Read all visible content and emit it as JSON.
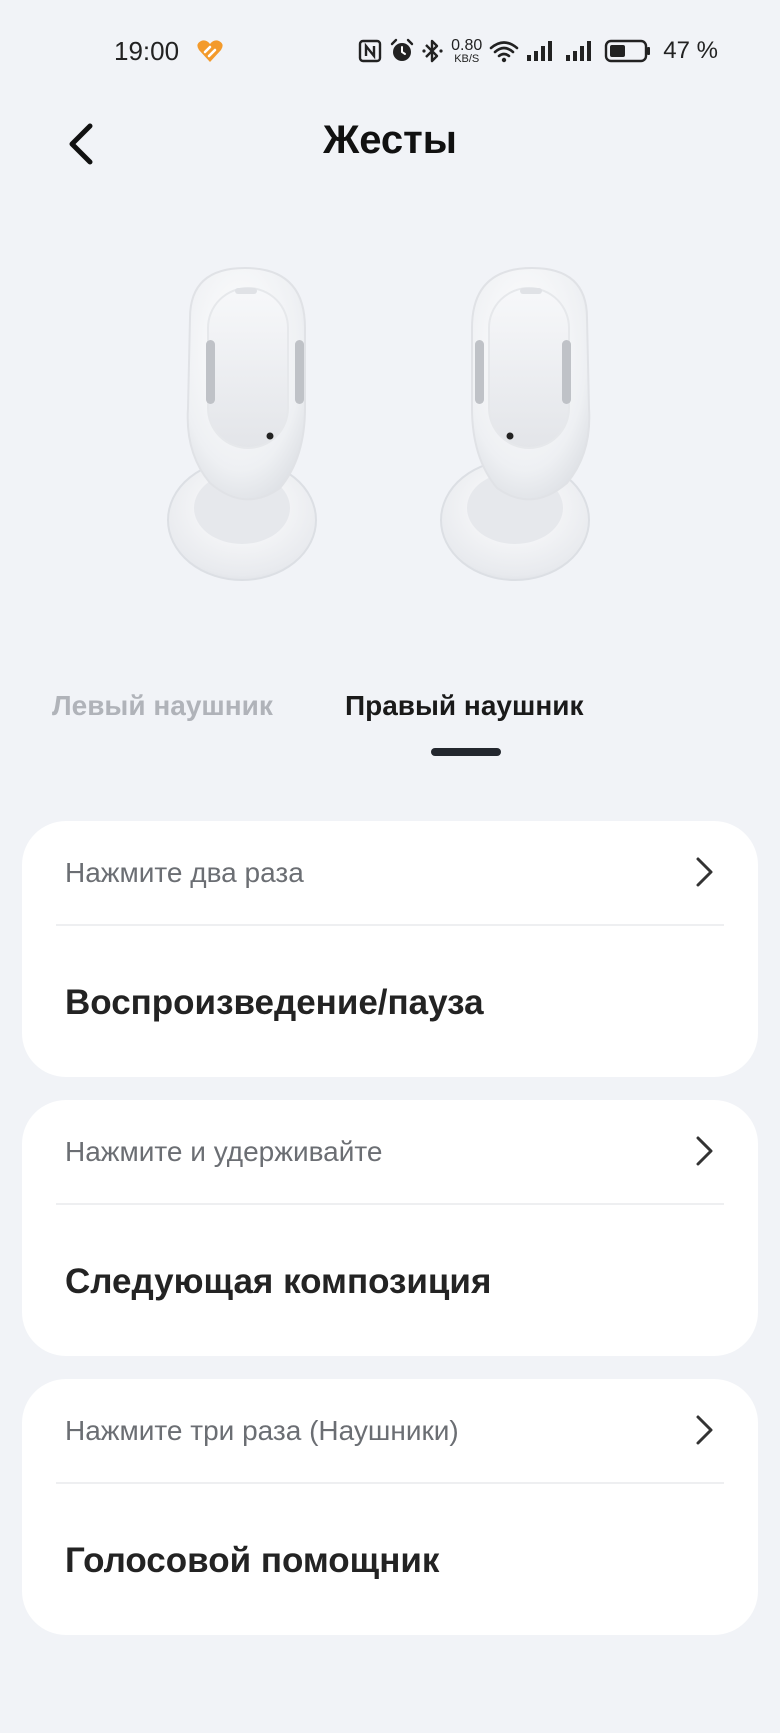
{
  "status_bar": {
    "time": "19:00",
    "app_icon": "orange-heart-icon",
    "icons": [
      "nfc-icon",
      "alarm-icon",
      "bluetooth-icon",
      "wifi-icon",
      "signal-icon",
      "signal-icon",
      "battery-icon"
    ],
    "net_speed_value": "0.80",
    "net_speed_unit": "KB/S",
    "battery_percent": "47 %",
    "battery_level": 0.47
  },
  "header": {
    "title": "Жесты",
    "back_icon": "chevron-left-icon"
  },
  "illustration": {
    "subject": "earbuds-image"
  },
  "tabs": {
    "items": [
      {
        "label": "Левый наушник",
        "active": false
      },
      {
        "label": "Правый наушник",
        "active": true
      }
    ]
  },
  "gestures": [
    {
      "label": "Нажмите два раза",
      "value": "Воспроизведение/пауза"
    },
    {
      "label": "Нажмите и удерживайте",
      "value": "Следующая композиция"
    },
    {
      "label": "Нажмите три раза (Наушники)",
      "value": "Голосовой помощник"
    }
  ],
  "colors": {
    "background": "#f1f3f7",
    "card": "#ffffff",
    "accent_app_icon": "#f39a2b",
    "tab_active": "#1a1a1a",
    "tab_inactive": "#b0b3b9"
  }
}
